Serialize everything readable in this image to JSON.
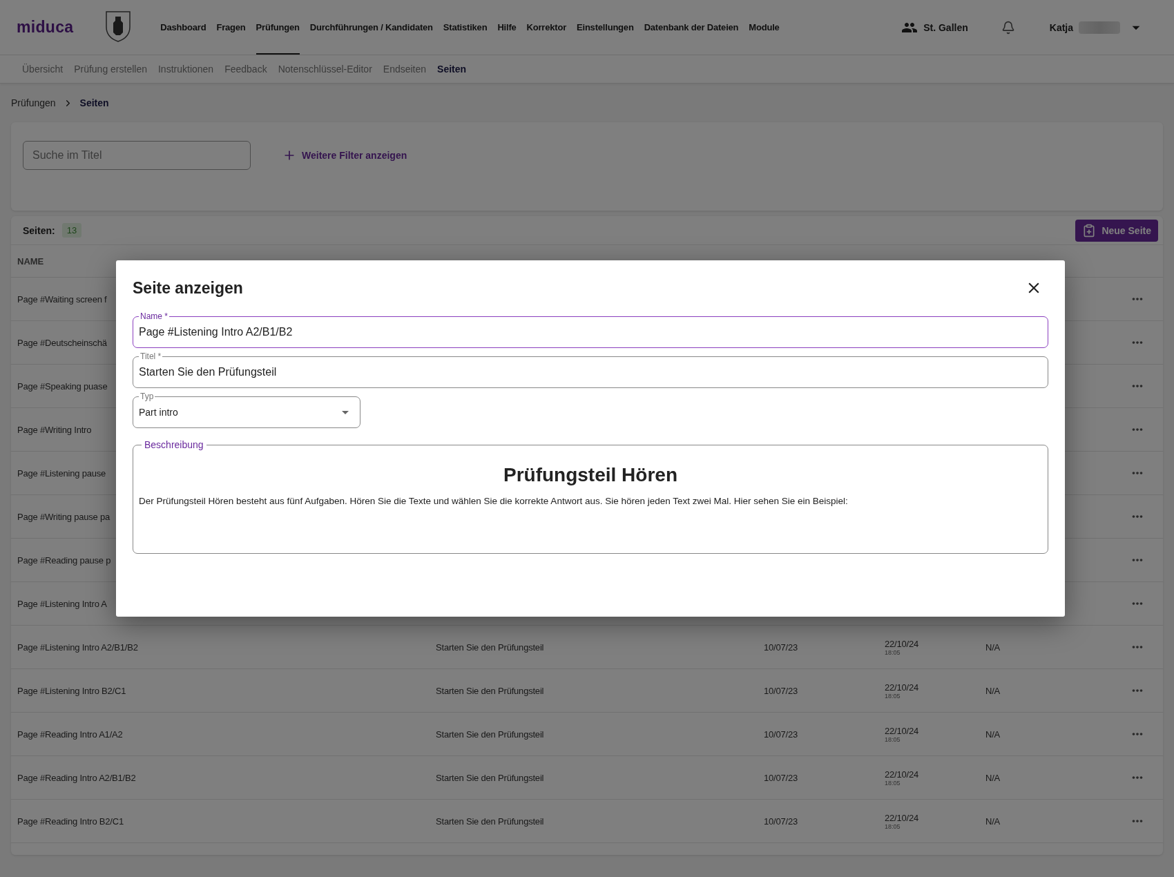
{
  "header": {
    "logo": "miduca",
    "nav": [
      {
        "label": "Dashboard",
        "selected": false
      },
      {
        "label": "Fragen",
        "selected": false
      },
      {
        "label": "Prüfungen",
        "selected": true
      },
      {
        "label": "Durchführungen / Kandidaten",
        "selected": false
      },
      {
        "label": "Statistiken",
        "selected": false
      },
      {
        "label": "Hilfe",
        "selected": false
      },
      {
        "label": "Korrektor",
        "selected": false
      },
      {
        "label": "Einstellungen",
        "selected": false
      },
      {
        "label": "Datenbank der Dateien",
        "selected": false
      },
      {
        "label": "Module",
        "selected": false
      }
    ],
    "location": "St. Gallen",
    "user": "Katja"
  },
  "subnav": [
    {
      "label": "Übersicht",
      "selected": false
    },
    {
      "label": "Prüfung erstellen",
      "selected": false
    },
    {
      "label": "Instruktionen",
      "selected": false
    },
    {
      "label": "Feedback",
      "selected": false
    },
    {
      "label": "Notenschlüssel-Editor",
      "selected": false
    },
    {
      "label": "Endseiten",
      "selected": false
    },
    {
      "label": "Seiten",
      "selected": true
    }
  ],
  "breadcrumb": [
    "Prüfungen",
    "Seiten"
  ],
  "filters": {
    "placeholder": "Suche im Titel",
    "more_filters": "Weitere Filter anzeigen"
  },
  "table": {
    "count_label": "Seiten:",
    "count": "13",
    "new_button": "Neue Seite",
    "columns": [
      "NAME"
    ],
    "rows": [
      {
        "name": "Page #Waiting screen f"
      },
      {
        "name": "Page #Deutscheinschä"
      },
      {
        "name": "Page #Speaking puase"
      },
      {
        "name": "Page #Writing Intro"
      },
      {
        "name": "Page #Listening pause"
      },
      {
        "name": "Page #Writing pause pa"
      },
      {
        "name": "Page #Reading pause p"
      },
      {
        "name": "Page #Listening Intro A"
      },
      {
        "name": "Page #Listening Intro A2/B1/B2",
        "title": "Starten Sie den Prüfungsteil",
        "created": "10/07/23",
        "modified_date": "22/10/24",
        "modified_time": "18:05",
        "used": "N/A"
      },
      {
        "name": "Page #Listening Intro B2/C1",
        "title": "Starten Sie den Prüfungsteil",
        "created": "10/07/23",
        "modified_date": "22/10/24",
        "modified_time": "18:05",
        "used": "N/A"
      },
      {
        "name": "Page #Reading Intro A1/A2",
        "title": "Starten Sie den Prüfungsteil",
        "created": "10/07/23",
        "modified_date": "22/10/24",
        "modified_time": "18:05",
        "used": "N/A"
      },
      {
        "name": "Page #Reading Intro A2/B1/B2",
        "title": "Starten Sie den Prüfungsteil",
        "created": "10/07/23",
        "modified_date": "22/10/24",
        "modified_time": "18:05",
        "used": "N/A"
      },
      {
        "name": "Page #Reading Intro B2/C1",
        "title": "Starten Sie den Prüfungsteil",
        "created": "10/07/23",
        "modified_date": "22/10/24",
        "modified_time": "18:05",
        "used": "N/A"
      }
    ]
  },
  "dialog": {
    "title": "Seite anzeigen",
    "fields": [
      {
        "kind": "text",
        "label": "Name *",
        "value": "Page #Listening Intro A2/B1/B2",
        "focused": true
      },
      {
        "kind": "text",
        "label": "Titel *",
        "value": "Starten Sie den Prüfungsteil",
        "focused": false
      },
      {
        "kind": "select",
        "label": "Typ",
        "value": "Part intro",
        "focused": false
      }
    ],
    "description": {
      "label": "Beschreibung",
      "heading": "Prüfungsteil Hören",
      "text": "Der Prüfungsteil Hören besteht aus fünf Aufgaben. Hören Sie die Texte und wählen Sie die korrekte Antwort aus. Sie hören jeden Text zwei Mal. Hier sehen Sie ein Beispiel:"
    }
  }
}
